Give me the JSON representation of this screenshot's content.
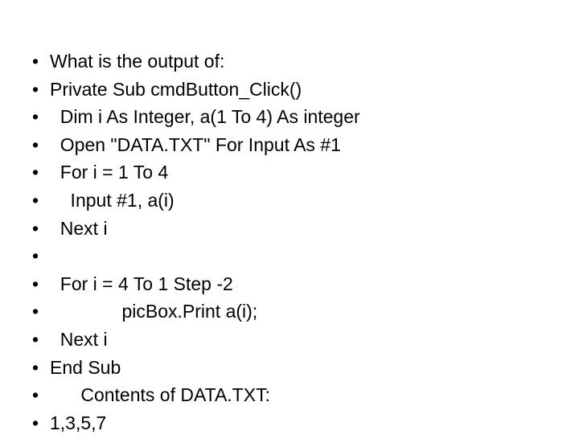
{
  "slide": {
    "background_color": "#ffffff",
    "text_color": "#000000",
    "bullet_glyph": "•",
    "lines": [
      {
        "indent": "",
        "text": "What is the output of:"
      },
      {
        "indent": "",
        "text": "Private Sub cmdButton_Click()"
      },
      {
        "indent": "  ",
        "text": "Dim i As Integer, a(1 To 4) As integer"
      },
      {
        "indent": "  ",
        "text": "Open \"DATA.TXT\" For Input As #1"
      },
      {
        "indent": "  ",
        "text": "For i = 1 To 4"
      },
      {
        "indent": "    ",
        "text": "Input #1, a(i)"
      },
      {
        "indent": "  ",
        "text": "Next i"
      },
      {
        "indent": "",
        "text": ""
      },
      {
        "indent": "  ",
        "text": "For i = 4 To 1 Step -2"
      },
      {
        "indent": "              ",
        "text": "picBox.Print a(i);"
      },
      {
        "indent": "  ",
        "text": "Next i"
      },
      {
        "indent": "",
        "text": "End Sub"
      },
      {
        "indent": "      ",
        "text": "Contents of DATA.TXT:"
      },
      {
        "indent": "",
        "text": "1,3,5,7"
      }
    ]
  }
}
